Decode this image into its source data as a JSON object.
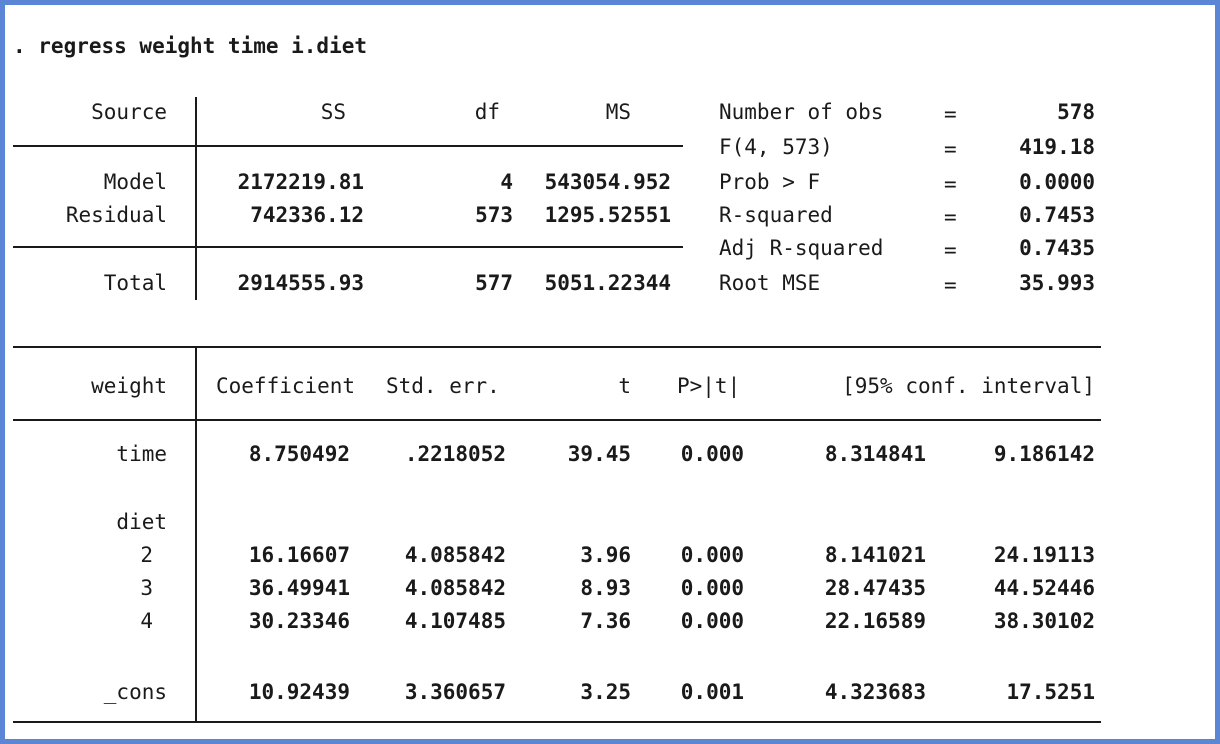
{
  "command": ". regress weight time i.diet",
  "anova": {
    "headers": {
      "source": "Source",
      "ss": "SS",
      "df": "df",
      "ms": "MS"
    },
    "rows": [
      {
        "source": "Model",
        "ss": "2172219.81",
        "df": "4",
        "ms": "543054.952"
      },
      {
        "source": "Residual",
        "ss": "742336.12",
        "df": "573",
        "ms": "1295.52551"
      },
      {
        "source": "Total",
        "ss": "2914555.93",
        "df": "577",
        "ms": "5051.22344"
      }
    ]
  },
  "stats": [
    {
      "label": "Number of obs",
      "eq": "=",
      "value": "578"
    },
    {
      "label": "F(4, 573)",
      "eq": "=",
      "value": "419.18"
    },
    {
      "label": "Prob > F",
      "eq": "=",
      "value": "0.0000"
    },
    {
      "label": "R-squared",
      "eq": "=",
      "value": "0.7453"
    },
    {
      "label": "Adj R-squared",
      "eq": "=",
      "value": "0.7435"
    },
    {
      "label": "Root MSE",
      "eq": "=",
      "value": "35.993"
    }
  ],
  "coef": {
    "headers": {
      "var": "weight",
      "coefficient": "Coefficient",
      "stderr": "Std. err.",
      "t": "t",
      "p": "P>|t|",
      "ci": "[95% conf. interval]"
    },
    "rows": [
      {
        "var": "time",
        "coefficient": "8.750492",
        "stderr": ".2218052",
        "t": "39.45",
        "p": "0.000",
        "lo": "8.314841",
        "hi": "9.186142"
      },
      {
        "var": "diet"
      },
      {
        "var": "2",
        "coefficient": "16.16607",
        "stderr": "4.085842",
        "t": "3.96",
        "p": "0.000",
        "lo": "8.141021",
        "hi": "24.19113"
      },
      {
        "var": "3",
        "coefficient": "36.49941",
        "stderr": "4.085842",
        "t": "8.93",
        "p": "0.000",
        "lo": "28.47435",
        "hi": "44.52446"
      },
      {
        "var": "4",
        "coefficient": "30.23346",
        "stderr": "4.107485",
        "t": "7.36",
        "p": "0.000",
        "lo": "22.16589",
        "hi": "38.30102"
      },
      {
        "var": "_cons",
        "coefficient": "10.92439",
        "stderr": "3.360657",
        "t": "3.25",
        "p": "0.001",
        "lo": "4.323683",
        "hi": "17.5251"
      }
    ]
  },
  "colors": {
    "frame": "#5b86d6",
    "text": "#1a1a1a",
    "background": "#ffffff"
  }
}
